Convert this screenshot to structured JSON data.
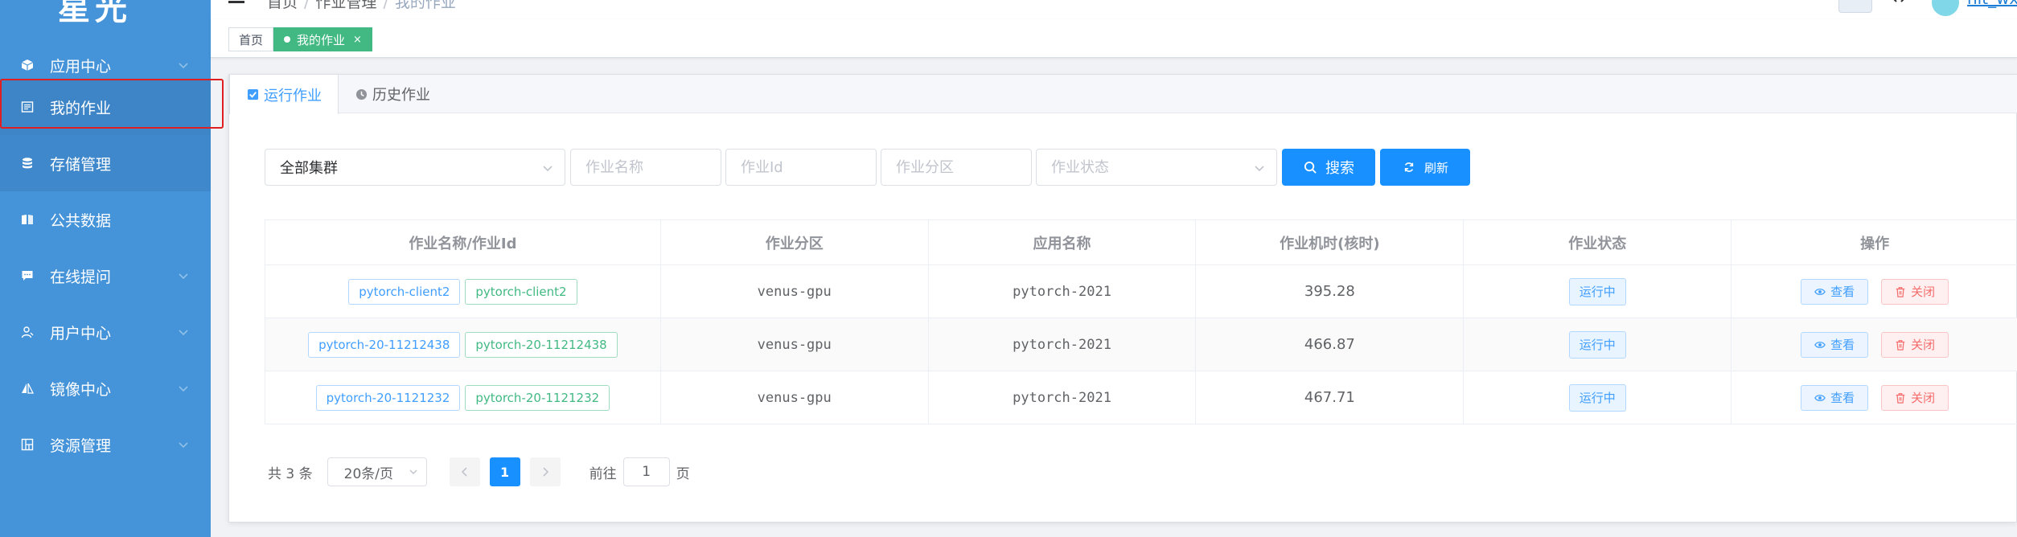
{
  "sidebar": {
    "logo": "星光",
    "items": [
      {
        "label": "应用中心",
        "icon": "cube-icon",
        "has_arrow": true
      },
      {
        "label": "我的作业",
        "icon": "list-icon",
        "has_arrow": false
      },
      {
        "label": "存储管理",
        "icon": "database-icon",
        "has_arrow": false
      },
      {
        "label": "公共数据",
        "icon": "book-icon",
        "has_arrow": false
      },
      {
        "label": "在线提问",
        "icon": "chat-icon",
        "has_arrow": true
      },
      {
        "label": "用户中心",
        "icon": "user-icon",
        "has_arrow": true
      },
      {
        "label": "镜像中心",
        "icon": "mirror-icon",
        "has_arrow": true
      },
      {
        "label": "资源管理",
        "icon": "grid-icon",
        "has_arrow": true
      }
    ],
    "colors": {
      "bg": "#4593d8",
      "highlight": "#e02020"
    }
  },
  "header": {
    "breadcrumb": [
      "首页",
      "作业管理",
      "我的作业"
    ],
    "user": "hit_wx"
  },
  "tags_bar": {
    "home": "首页",
    "active": "我的作业",
    "close": "×"
  },
  "tabs": [
    {
      "label": "运行作业",
      "icon": "checkbox-icon",
      "active": true
    },
    {
      "label": "历史作业",
      "icon": "clock-icon",
      "active": false
    }
  ],
  "filters": {
    "cluster_value": "全部集群",
    "job_name_placeholder": "作业名称",
    "job_id_placeholder": "作业Id",
    "partition_placeholder": "作业分区",
    "status_placeholder": "作业状态",
    "search_label": "搜索",
    "refresh_label": "刷新"
  },
  "table": {
    "headers": [
      "作业名称/作业Id",
      "作业分区",
      "应用名称",
      "作业机时(核时)",
      "作业状态",
      "操作"
    ],
    "rows": [
      {
        "name": "pytorch-client2",
        "id": "pytorch-client2",
        "partition": "venus-gpu",
        "app": "pytorch-2021",
        "hours": "395.28",
        "status": "运行中"
      },
      {
        "name": "pytorch-20-11212438",
        "id": "pytorch-20-11212438",
        "partition": "venus-gpu",
        "app": "pytorch-2021",
        "hours": "466.87",
        "status": "运行中"
      },
      {
        "name": "pytorch-20-1121232",
        "id": "pytorch-20-1121232",
        "partition": "venus-gpu",
        "app": "pytorch-2021",
        "hours": "467.71",
        "status": "运行中"
      }
    ],
    "view_label": "查看",
    "close_label": "关闭"
  },
  "pagination": {
    "total": "共 3 条",
    "page_size": "20条/页",
    "current_page": "1",
    "goto_prefix": "前往",
    "goto_value": "1",
    "goto_suffix": "页"
  }
}
